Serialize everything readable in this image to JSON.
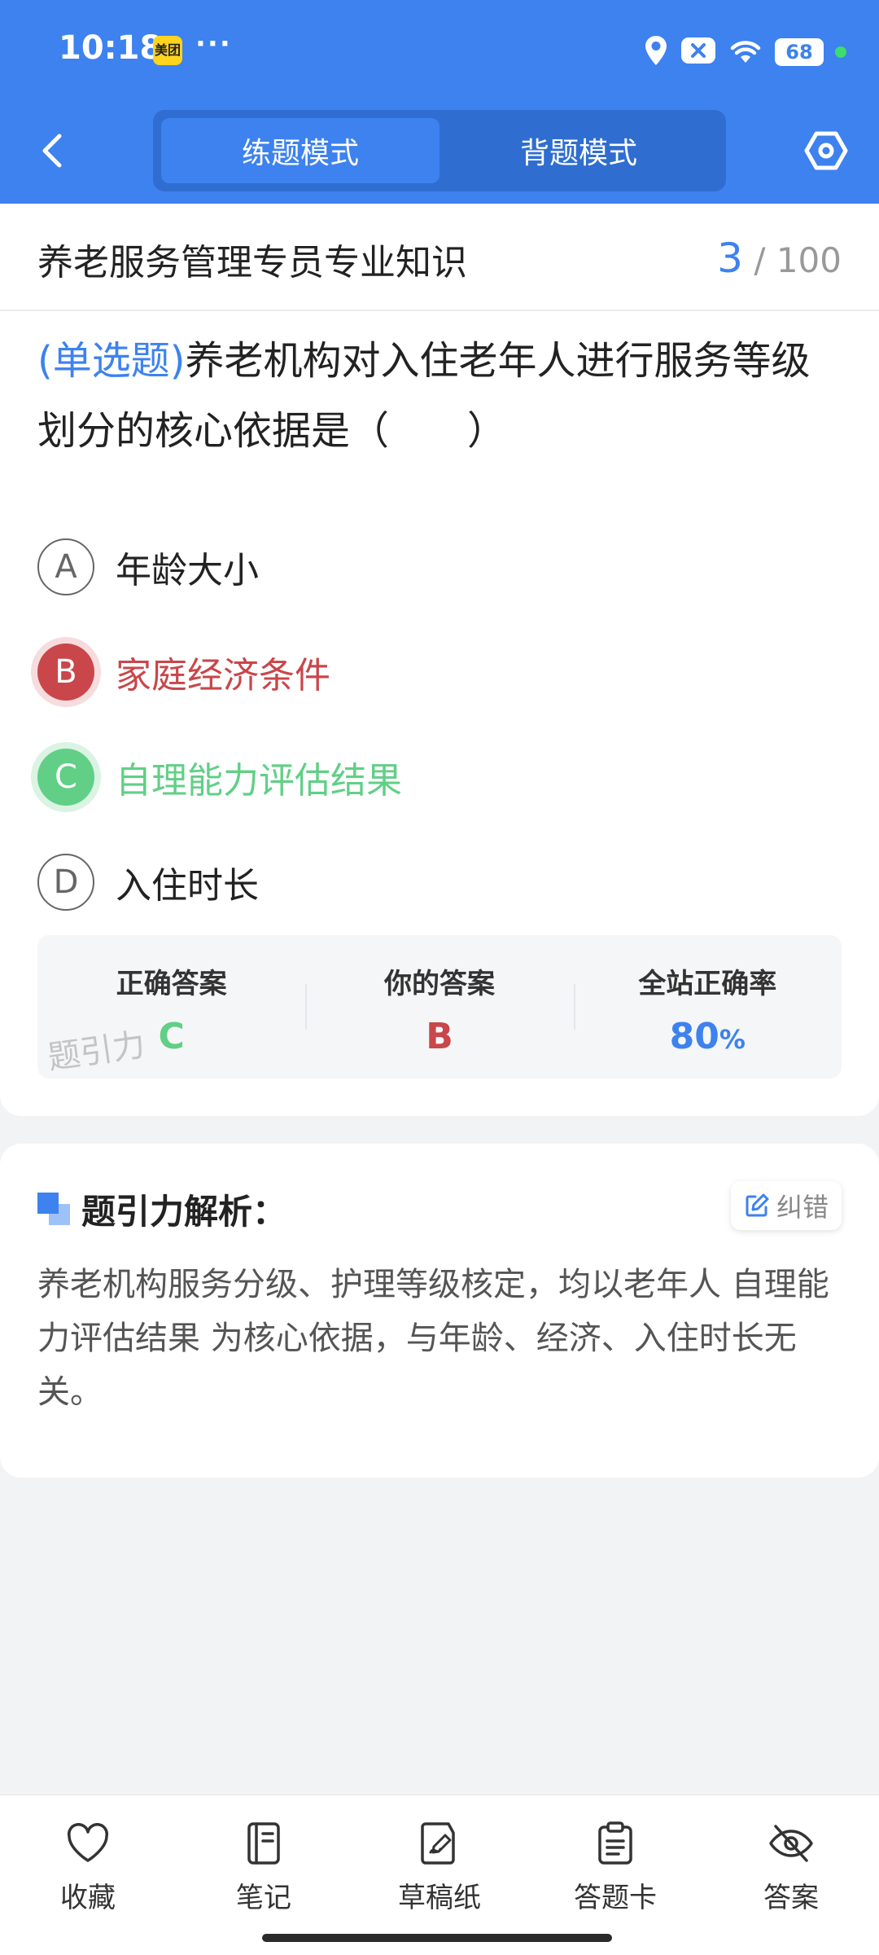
{
  "status_bar": {
    "time": "10:18",
    "app_badge": "美团",
    "more": "···",
    "battery": "68"
  },
  "nav": {
    "tabs": [
      {
        "label": "练题模式",
        "active": true
      },
      {
        "label": "背题模式",
        "active": false
      }
    ]
  },
  "question": {
    "subject": "养老服务管理专员专业知识",
    "current": "3",
    "separator": "/",
    "total": "100",
    "type": "(单选题)",
    "text": "养老机构对入住老年人进行服务等级划分的核心依据是（　　）",
    "options": [
      {
        "letter": "A",
        "text": "年龄大小",
        "state": "normal"
      },
      {
        "letter": "B",
        "text": "家庭经济条件",
        "state": "wrong"
      },
      {
        "letter": "C",
        "text": "自理能力评估结果",
        "state": "correct"
      },
      {
        "letter": "D",
        "text": "入住时长",
        "state": "normal"
      }
    ]
  },
  "answer_summary": {
    "correct_label": "正确答案",
    "correct_value": "C",
    "yours_label": "你的答案",
    "yours_value": "B",
    "rate_label": "全站正确率",
    "rate_value": "80",
    "rate_unit": "%",
    "watermark": "题引力"
  },
  "analysis": {
    "title": "题引力解析：",
    "correct_button": "纠错",
    "text": "养老机构服务分级、护理等级核定，均以老年人 自理能力评估结果 为核心依据，与年龄、经济、入住时长无关。"
  },
  "bottom_bar": {
    "items": [
      {
        "label": "收藏",
        "icon": "heart-icon"
      },
      {
        "label": "笔记",
        "icon": "notebook-icon"
      },
      {
        "label": "草稿纸",
        "icon": "draft-icon"
      },
      {
        "label": "答题卡",
        "icon": "clipboard-icon"
      },
      {
        "label": "答案",
        "icon": "eye-off-icon"
      }
    ]
  },
  "colors": {
    "primary": "#3d82ee",
    "wrong": "#c9464a",
    "correct": "#61cf86"
  }
}
